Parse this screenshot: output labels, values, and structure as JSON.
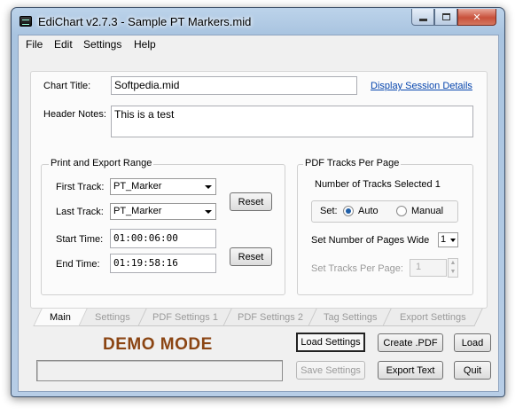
{
  "window": {
    "title": "EdiChart v2.7.3 - Sample PT Markers.mid"
  },
  "menu": [
    "File",
    "Edit",
    "Settings",
    "Help"
  ],
  "form": {
    "chart_title_label": "Chart Title:",
    "chart_title_value": "Softpedia.mid",
    "display_session_link": "Display Session Details",
    "header_notes_label": "Header Notes:",
    "header_notes_value": "This is a test"
  },
  "range": {
    "title": "Print and Export Range",
    "first_track_label": "First Track:",
    "first_track_value": "PT_Marker",
    "last_track_label": "Last Track:",
    "last_track_value": "PT_Marker",
    "start_time_label": "Start Time:",
    "start_time_value": "01:00:06:00",
    "end_time_label": "End Time:",
    "end_time_value": "01:19:58:16",
    "reset_label": "Reset"
  },
  "pdf": {
    "title": "PDF Tracks Per Page",
    "tracks_selected": "Number of Tracks Selected 1",
    "set_label": "Set:",
    "auto_label": "Auto",
    "manual_label": "Manual",
    "auto_checked": true,
    "pages_wide_label": "Set Number of Pages Wide",
    "pages_wide_value": "1",
    "tracks_per_page_label": "Set Tracks Per Page:",
    "tracks_per_page_value": "1"
  },
  "tabs": [
    "Main",
    "Settings",
    "PDF Settings 1",
    "PDF Settings 2",
    "Tag Settings",
    "Export Settings"
  ],
  "active_tab": "Main",
  "demo_label": "DEMO MODE",
  "buttons": {
    "load_settings": "Load Settings",
    "create_pdf": "Create .PDF",
    "load": "Load",
    "save_settings": "Save Settings",
    "export_text": "Export Text",
    "quit": "Quit"
  }
}
